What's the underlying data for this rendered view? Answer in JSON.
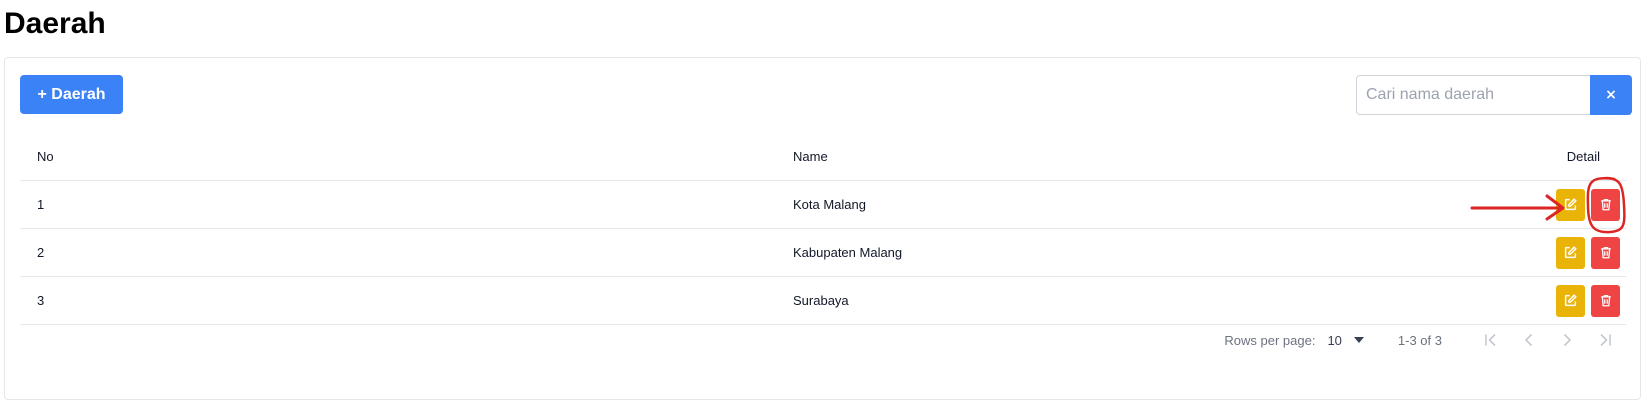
{
  "page": {
    "title": "Daerah"
  },
  "toolbar": {
    "add_label": "+ Daerah"
  },
  "search": {
    "placeholder": "Cari nama daerah",
    "value": "",
    "clear_label": "×"
  },
  "table": {
    "columns": {
      "no": "No",
      "name": "Name",
      "detail": "Detail"
    },
    "rows": [
      {
        "no": "1",
        "name": "Kota Malang"
      },
      {
        "no": "2",
        "name": "Kabupaten Malang"
      },
      {
        "no": "3",
        "name": "Surabaya"
      }
    ]
  },
  "pagination": {
    "rows_per_page_label": "Rows per page:",
    "rows_per_page_value": "10",
    "range": "1-3 of 3"
  },
  "colors": {
    "primary": "#3b82f6",
    "edit": "#eab308",
    "delete": "#ef4444",
    "annotation": "#dc2626"
  },
  "icons": {
    "edit": "pencil-square-icon",
    "delete": "trash-icon",
    "pager": [
      "first-page-icon",
      "prev-page-icon",
      "next-page-icon",
      "last-page-icon"
    ]
  }
}
